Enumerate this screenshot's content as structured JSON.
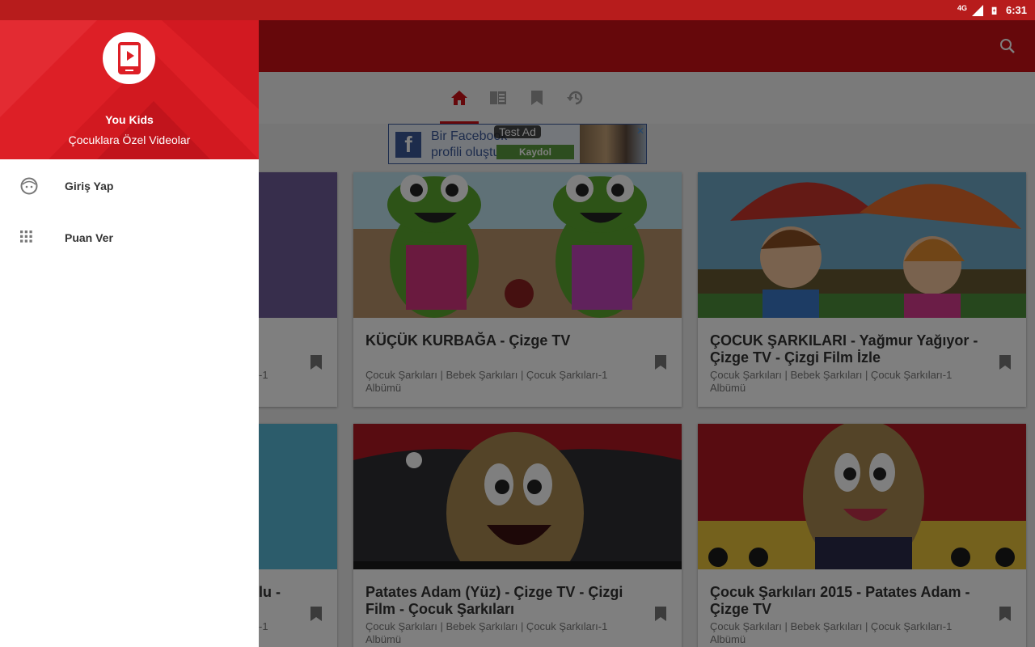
{
  "status_bar": {
    "network": "4G",
    "time": "6:31"
  },
  "app_bar": {
    "search_icon": "search-icon"
  },
  "tabs": [
    {
      "icon": "home-icon",
      "active": true
    },
    {
      "icon": "book-icon",
      "active": false
    },
    {
      "icon": "bookmark-icon",
      "active": false
    },
    {
      "icon": "history-icon",
      "active": false
    }
  ],
  "ad": {
    "label": "Test Ad",
    "line1": "Bir Facebook",
    "line2": "profili oluştur",
    "cta": "Kaydol",
    "close": "✕"
  },
  "videos": [
    {
      "title": "KÜÇÜK KURBAĞA - Çizge TV",
      "subtitle": "Çocuk Şarkıları | Bebek Şarkıları | Çocuk Şarkıları-1 Albümü"
    },
    {
      "title": "ÇOCUK ŞARKILARI - Yağmur Yağıyor - Çizge TV - Çizgi Film İzle",
      "subtitle": "Çocuk Şarkıları | Bebek Şarkıları | Çocuk Şarkıları-1 Albümü"
    },
    {
      "title": "Patates Adam (Yüz) - Çizge TV - Çizgi Film - Çocuk Şarkıları",
      "subtitle": "Çocuk Şarkıları | Bebek Şarkıları | Çocuk Şarkıları-1 Albümü"
    },
    {
      "title": "Çocuk Şarkıları 2015 - Patates Adam - Çizge TV",
      "subtitle": "Çocuk Şarkıları | Bebek Şarkıları | Çocuk Şarkıları-1 Albümü"
    },
    {
      "title_fragment": "lu -",
      "subtitle_fragment": "-1"
    },
    {
      "subtitle_fragment": "-1"
    }
  ],
  "drawer": {
    "app_name": "You Kids",
    "tagline": "Çocuklara Özel Videolar",
    "menu": [
      {
        "label": "Giriş Yap",
        "icon": "face-icon"
      },
      {
        "label": "Puan Ver",
        "icon": "apps-grid-icon"
      }
    ]
  },
  "colors": {
    "brand_red": "#cc1016",
    "drawer_header": "#dd1f26",
    "status_bar": "#b71c1c"
  }
}
